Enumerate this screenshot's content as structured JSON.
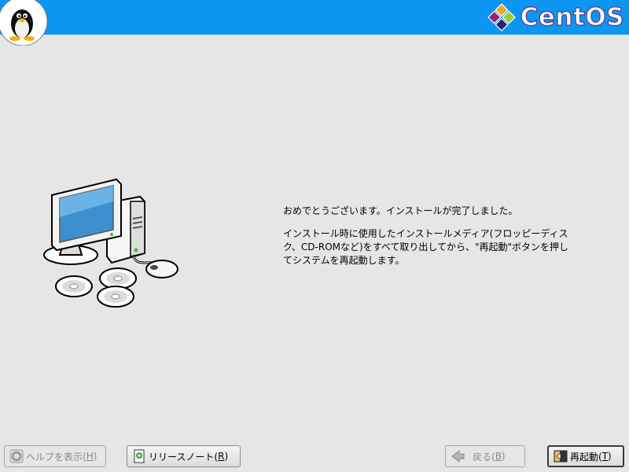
{
  "header": {
    "brand_name": "CentOS",
    "logo_icon": "centos-logo-icon",
    "mascot_icon": "tux-penguin-icon",
    "bar_color": "#0c96f2"
  },
  "main": {
    "message_line1": "おめでとうございます。インストールが完了しました。",
    "message_line2": "インストール時に使用したインストールメディア(フロッピーディスク、CD-ROMなど)をすべて取り出してから、\"再起動\"ボタンを押してシステムを再起動します。",
    "illustration_icon": "computer-with-discs-icon"
  },
  "buttons": {
    "help": {
      "label": "ヘルプを表示(",
      "mnemonic": "H",
      "suffix": ")",
      "icon": "help-icon",
      "enabled": false
    },
    "release_notes": {
      "label": "リリースノート(",
      "mnemonic": "R",
      "suffix": ")",
      "icon": "release-notes-icon",
      "enabled": true
    },
    "back": {
      "label": "戻る(",
      "mnemonic": "B",
      "suffix": ")",
      "icon": "back-arrow-icon",
      "enabled": false
    },
    "reboot": {
      "label": "再起動(",
      "mnemonic": "T",
      "suffix": ")",
      "icon": "reboot-icon",
      "enabled": true
    }
  }
}
